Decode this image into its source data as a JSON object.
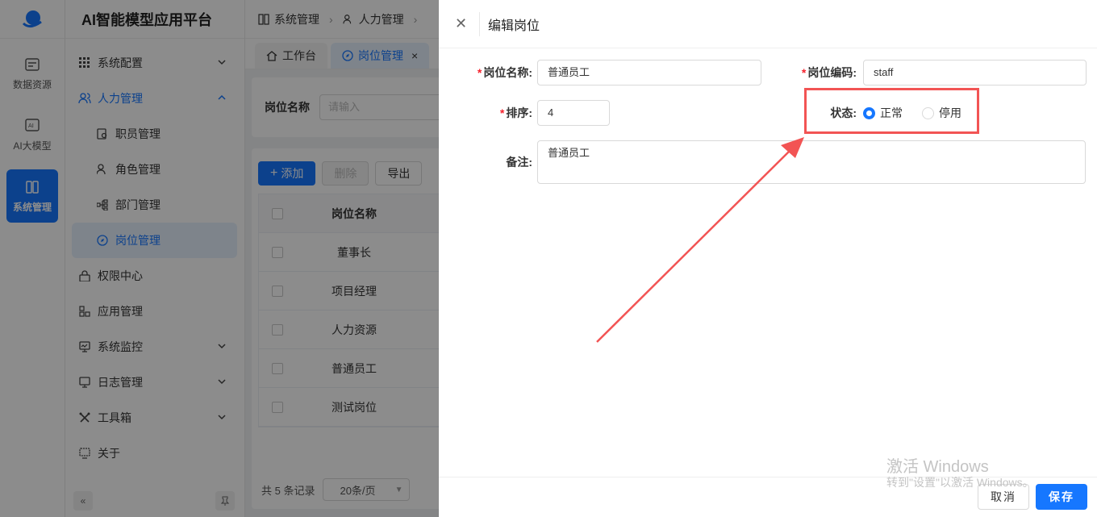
{
  "rail": {
    "items": [
      {
        "label": "数据资源",
        "icon": "database-icon"
      },
      {
        "label": "AI大模型",
        "icon": "ai-icon"
      },
      {
        "label": "系统管理",
        "icon": "system-icon"
      }
    ]
  },
  "sidebar": {
    "brand": "AI智能模型应用平台",
    "items": [
      {
        "label": "系统配置"
      },
      {
        "label": "人力管理"
      },
      {
        "label": "职员管理"
      },
      {
        "label": "角色管理"
      },
      {
        "label": "部门管理"
      },
      {
        "label": "岗位管理"
      },
      {
        "label": "权限中心"
      },
      {
        "label": "应用管理"
      },
      {
        "label": "系统监控"
      },
      {
        "label": "日志管理"
      },
      {
        "label": "工具箱"
      },
      {
        "label": "关于"
      }
    ],
    "collapse_glyph": "«"
  },
  "breadcrumb": {
    "items": [
      "系统管理",
      "人力管理"
    ]
  },
  "tabs": [
    {
      "label": "工作台"
    },
    {
      "label": "岗位管理"
    }
  ],
  "search": {
    "label": "岗位名称",
    "placeholder": "请输入"
  },
  "toolbar": {
    "add_label": "添加",
    "delete_label": "删除",
    "export_label": "导出"
  },
  "table": {
    "header": "岗位名称",
    "rows": [
      "董事长",
      "项目经理",
      "人力资源",
      "普通员工",
      "测试岗位"
    ]
  },
  "pager": {
    "total_text": "共 5 条记录",
    "page_size": "20条/页"
  },
  "drawer": {
    "title": "编辑岗位",
    "fields": {
      "name_label": "岗位名称:",
      "name_value": "普通员工",
      "code_label": "岗位编码:",
      "code_value": "staff",
      "sort_label": "排序:",
      "sort_value": "4",
      "status_label": "状态:",
      "status_options": [
        "正常",
        "停用"
      ],
      "status_selected": "正常",
      "remark_label": "备注:",
      "remark_value": "普通员工"
    },
    "cancel_label": "取消",
    "save_label": "保存"
  },
  "watermark": {
    "line1": "激活 Windows",
    "line2": "转到\"设置\"以激活 Windows。"
  },
  "colors": {
    "accent": "#1677ff",
    "required": "#f5222d",
    "highlight": "#f25454"
  }
}
